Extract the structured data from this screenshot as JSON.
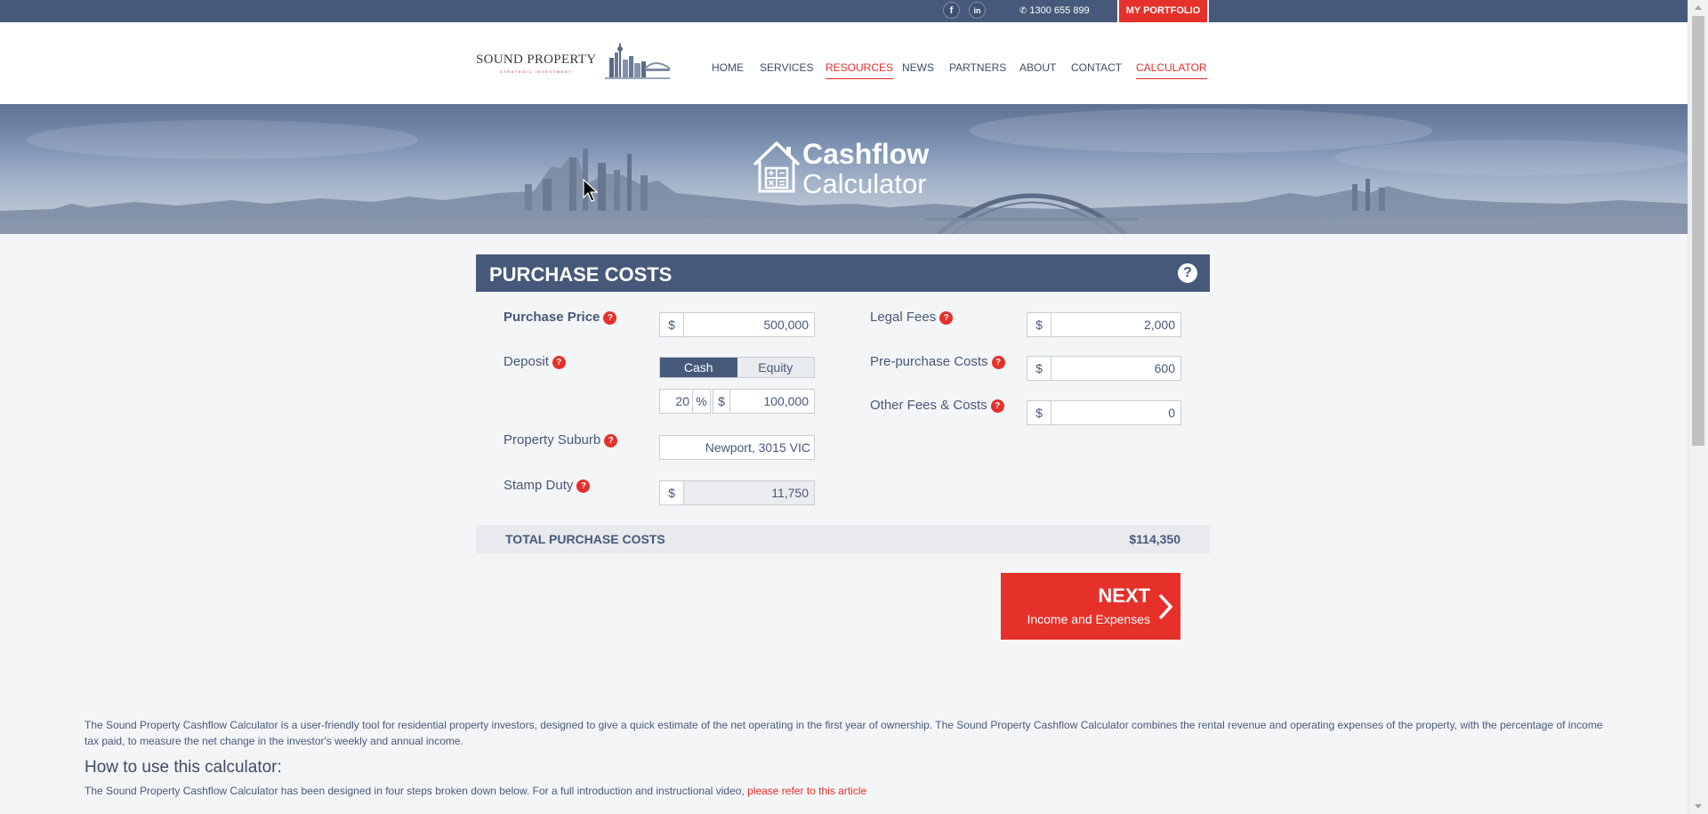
{
  "topbar": {
    "facebook_icon": "f",
    "linkedin_icon": "in",
    "phone": "1300 655 899",
    "portfolio_label": "MY PORTFOLIO"
  },
  "logo": {
    "name": "SOUND PROPERTY",
    "tagline": "STRATEGIC INVESTMENT"
  },
  "nav": {
    "items": [
      {
        "label": "HOME",
        "active": false
      },
      {
        "label": "SERVICES",
        "active": false
      },
      {
        "label": "RESOURCES",
        "active": true
      },
      {
        "label": "NEWS",
        "active": false
      },
      {
        "label": "PARTNERS",
        "active": false
      },
      {
        "label": "ABOUT",
        "active": false
      },
      {
        "label": "CONTACT",
        "active": false
      },
      {
        "label": "CALCULATOR",
        "active": true
      }
    ]
  },
  "hero": {
    "title_line1": "Cashflow",
    "title_line2": "Calculator"
  },
  "panel": {
    "title": "PURCHASE COSTS",
    "help_icon": "?",
    "fields": {
      "purchase_price": {
        "label": "Purchase Price",
        "prefix": "$",
        "value": "500,000"
      },
      "deposit": {
        "label": "Deposit",
        "toggle_options": [
          "Cash",
          "Equity"
        ],
        "selected": "Cash",
        "percent": "20",
        "percent_suffix": "%",
        "prefix": "$",
        "amount": "100,000"
      },
      "property_suburb": {
        "label": "Property Suburb",
        "value": "Newport, 3015 VIC"
      },
      "stamp_duty": {
        "label": "Stamp Duty",
        "prefix": "$",
        "value": "11,750"
      },
      "legal_fees": {
        "label": "Legal Fees",
        "prefix": "$",
        "value": "2,000"
      },
      "pre_purchase_costs": {
        "label": "Pre-purchase Costs",
        "prefix": "$",
        "value": "600"
      },
      "other_fees": {
        "label": "Other Fees & Costs",
        "prefix": "$",
        "value": "0"
      }
    },
    "total_label": "TOTAL PURCHASE COSTS",
    "total_value": "$114,350"
  },
  "next_button": {
    "label": "NEXT",
    "sublabel": "Income and Expenses"
  },
  "intro": {
    "text": "The Sound Property Cashflow Calculator is a user-friendly tool for residential property investors, designed to give a quick estimate of the net operating in the first year of ownership. The Sound Property Cashflow Calculator combines the rental revenue and operating expenses of the property, with the percentage of income tax paid, to measure the net change in the investor's weekly and annual income.",
    "howto_heading": "How to use this calculator:",
    "howto_text": "The Sound Property Cashflow Calculator has been designed in four steps broken down below. For a full introduction and instructional video, ",
    "howto_link": "please refer to this article"
  },
  "colors": {
    "primary": "#46597a",
    "accent": "#e6302a",
    "background": "#f4f5f7"
  }
}
